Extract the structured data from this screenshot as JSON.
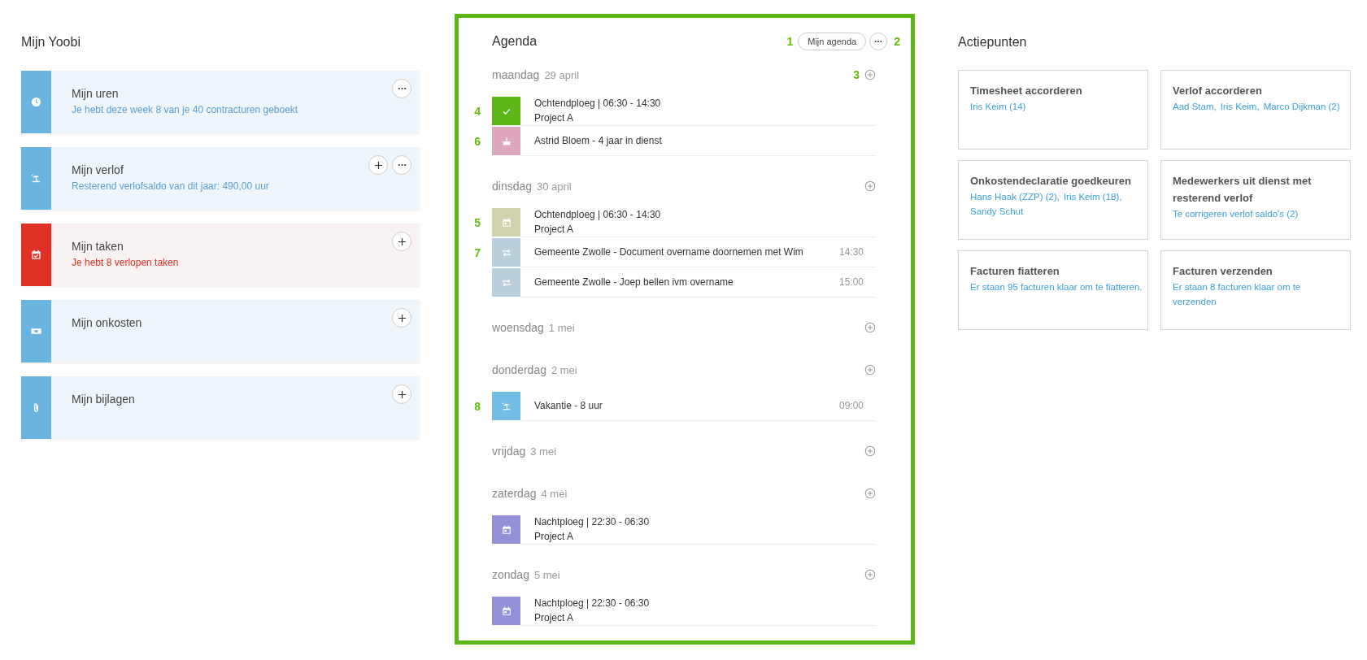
{
  "mijn_yoobi": {
    "title": "Mijn Yoobi",
    "cards": [
      {
        "kind": "hours",
        "color": "#6ab4e0",
        "title": "Mijn uren",
        "subtitle": "Je hebt deze week 8 van je 40 contracturen geboekt",
        "overdue": false,
        "buttons": [
          {
            "kind": "more"
          }
        ]
      },
      {
        "kind": "leave",
        "color": "#6ab4e0",
        "title": "Mijn verlof",
        "subtitle": "Resterend verlofsaldo van dit jaar: 490,00 uur",
        "overdue": false,
        "buttons": [
          {
            "kind": "add"
          },
          {
            "kind": "more"
          }
        ]
      },
      {
        "kind": "tasks",
        "color": "#e03127",
        "title": "Mijn taken",
        "subtitle": "Je hebt 8 verlopen taken",
        "overdue": true,
        "buttons": [
          {
            "kind": "add"
          }
        ]
      },
      {
        "kind": "expenses",
        "color": "#6ab4e0",
        "title": "Mijn onkosten",
        "buttons": [
          {
            "kind": "add"
          }
        ]
      },
      {
        "kind": "attachments",
        "color": "#6ab4e0",
        "title": "Mijn bijlagen",
        "buttons": [
          {
            "kind": "add"
          }
        ]
      }
    ]
  },
  "agenda": {
    "title": "Agenda",
    "marker_button": "1",
    "button": "Mijn agenda",
    "marker_more": "2",
    "days": [
      {
        "day": "maandag",
        "date": "29 april",
        "marker": "3",
        "items": [
          {
            "kind": "approved-shift",
            "color": "#5cb615",
            "marker": "4",
            "lines": [
              "Ochtendploeg | 06:30 - 14:30",
              "Project A"
            ]
          },
          {
            "kind": "anniversary",
            "color": "#dfa6c0",
            "marker": "6",
            "lines": [
              "Astrid Bloem - 4 jaar in dienst"
            ]
          }
        ]
      },
      {
        "day": "dinsdag",
        "date": "30 april",
        "items": [
          {
            "kind": "shift",
            "color": "#d0d3ad",
            "marker": "5",
            "lines": [
              "Ochtendploeg | 06:30 - 14:30",
              "Project A"
            ]
          },
          {
            "kind": "recurring",
            "color": "#bccfdc",
            "marker": "7",
            "lines": [
              "Gemeente Zwolle - Document overname doornemen met Wim"
            ],
            "time": "14:30"
          },
          {
            "kind": "recurring",
            "color": "#bccfdc",
            "lines": [
              "Gemeente Zwolle - Joep bellen ivm overname"
            ],
            "time": "15:00"
          }
        ]
      },
      {
        "day": "woensdag",
        "date": "1 mei"
      },
      {
        "day": "donderdag",
        "date": "2 mei",
        "items": [
          {
            "kind": "leave",
            "color": "#72bde6",
            "marker": "8",
            "lines": [
              "Vakantie - 8 uur"
            ],
            "time": "09:00"
          }
        ]
      },
      {
        "day": "vrijdag",
        "date": "3 mei"
      },
      {
        "day": "zaterdag",
        "date": "4 mei",
        "items": [
          {
            "kind": "shift",
            "color": "#9591d8",
            "lines": [
              "Nachtploeg | 22:30 - 06:30",
              "Project A"
            ]
          }
        ]
      },
      {
        "day": "zondag",
        "date": "5 mei",
        "items": [
          {
            "kind": "shift",
            "color": "#9591d8",
            "lines": [
              "Nachtploeg | 22:30 - 06:30",
              "Project A"
            ]
          }
        ]
      }
    ]
  },
  "actiepunten": {
    "title": "Actiepunten",
    "cards": [
      {
        "title": "Timesheet accorderen",
        "links": [
          "Iris Keim (14)"
        ]
      },
      {
        "title": "Verlof accorderen",
        "links": [
          "Aad Stam,",
          "Iris Keim,",
          "Marco Dijkman (2)"
        ]
      },
      {
        "title": "Onkostendeclaratie goedkeuren",
        "links": [
          "Hans Haak (ZZP) (2),",
          "Iris Keim (18),",
          "Sandy Schut"
        ]
      },
      {
        "title": "Medewerkers uit dienst met resterend verlof",
        "links": [
          "Te corrigeren verlof saldo's (2)"
        ]
      },
      {
        "title": "Facturen fiatteren",
        "links": [
          "Er staan 95 facturen klaar om te fiatteren."
        ]
      },
      {
        "title": "Facturen verzenden",
        "links": [
          "Er staan 8 facturen klaar om te verzenden"
        ]
      }
    ]
  }
}
